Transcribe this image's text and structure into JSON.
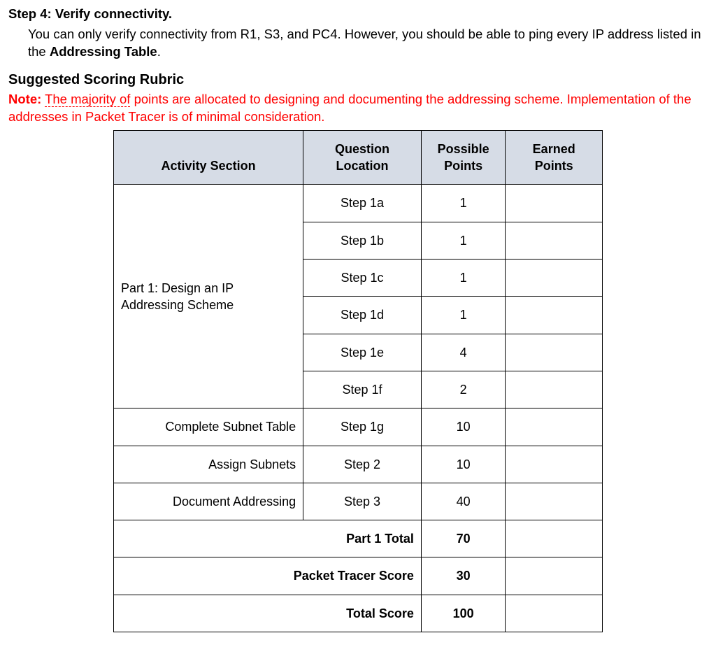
{
  "step4": {
    "heading": "Step 4: Verify connectivity.",
    "body_before": "You can only verify connectivity from R1, S3, and PC4. However, you should be able to ping every IP address listed in the ",
    "body_bold": "Addressing Table",
    "body_after": "."
  },
  "rubric_heading": "Suggested Scoring Rubric",
  "note": {
    "label": "Note:",
    "underlined": "The majority of",
    "rest": " points are allocated to designing and documenting the addressing scheme. Implementation of the addresses in Packet Tracer is of minimal consideration."
  },
  "table": {
    "headers": {
      "activity": "Activity Section",
      "question_location": "Question Location",
      "possible_points": "Possible Points",
      "earned_points": "Earned Points"
    },
    "part1_label": "Part 1: Design an IP Addressing Scheme",
    "rows_part1_steps": [
      {
        "qloc": "Step 1a",
        "points": "1",
        "earned": ""
      },
      {
        "qloc": "Step 1b",
        "points": "1",
        "earned": ""
      },
      {
        "qloc": "Step 1c",
        "points": "1",
        "earned": ""
      },
      {
        "qloc": "Step 1d",
        "points": "1",
        "earned": ""
      },
      {
        "qloc": "Step 1e",
        "points": "4",
        "earned": ""
      },
      {
        "qloc": "Step 1f",
        "points": "2",
        "earned": ""
      }
    ],
    "rows_named": [
      {
        "activity": "Complete Subnet Table",
        "qloc": "Step 1g",
        "points": "10",
        "earned": ""
      },
      {
        "activity": "Assign Subnets",
        "qloc": "Step 2",
        "points": "10",
        "earned": ""
      },
      {
        "activity": "Document Addressing",
        "qloc": "Step 3",
        "points": "40",
        "earned": ""
      }
    ],
    "part1_total": {
      "label": "Part 1 Total",
      "points": "70",
      "earned": ""
    },
    "packet_tracer": {
      "label": "Packet Tracer Score",
      "points": "30",
      "earned": ""
    },
    "total_score": {
      "label": "Total Score",
      "points": "100",
      "earned": ""
    }
  }
}
